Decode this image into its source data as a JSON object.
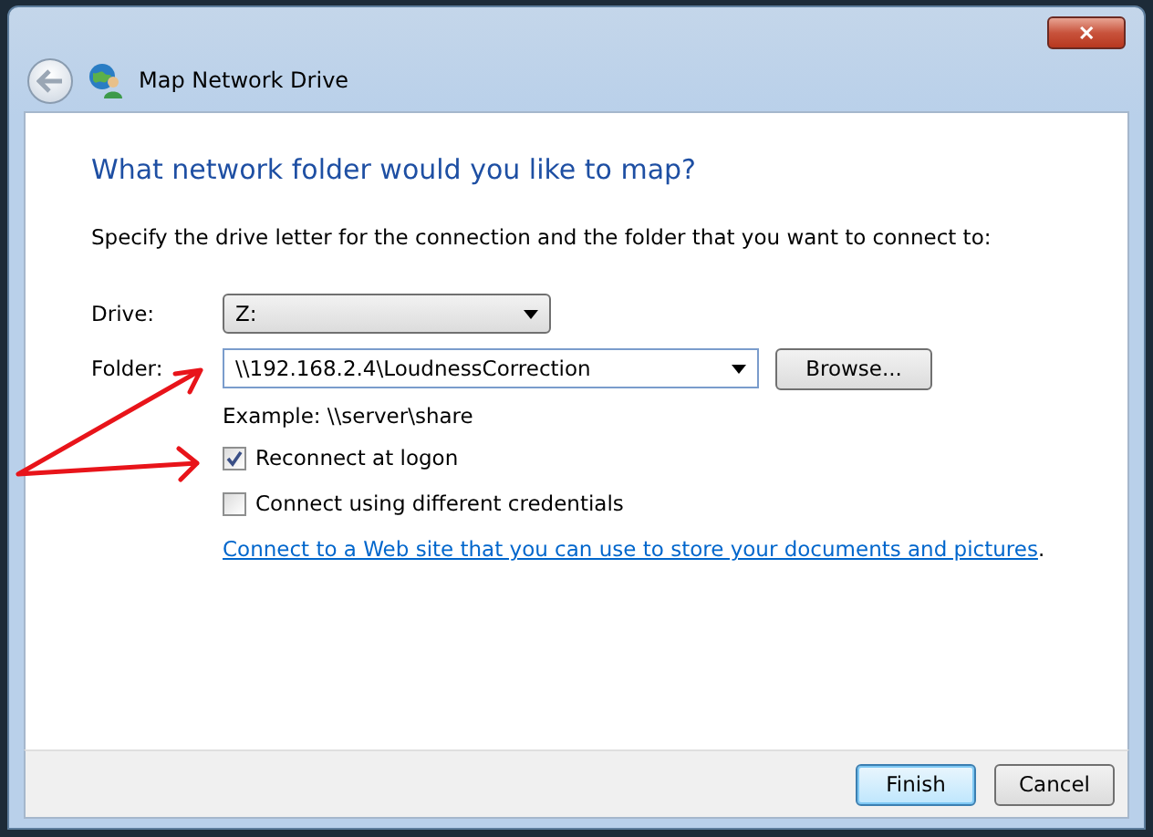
{
  "window": {
    "title": "Map Network Drive",
    "close": "✕"
  },
  "heading": "What network folder would you like to map?",
  "description": "Specify the drive letter for the connection and the folder that you want to connect to:",
  "drive": {
    "label": "Drive:",
    "value": "Z:"
  },
  "folder": {
    "label": "Folder:",
    "value": "\\\\192.168.2.4\\LoudnessCorrection",
    "browse": "Browse..."
  },
  "example": "Example: \\\\server\\share",
  "options": [
    {
      "label": "Reconnect at logon",
      "checked": true
    },
    {
      "label": "Connect using different credentials",
      "checked": false
    }
  ],
  "link": "Connect to a Web site that you can use to store your documents and pictures",
  "link_suffix": ".",
  "annotation_arrows": true,
  "buttons": [
    {
      "label": "Finish",
      "default": true
    },
    {
      "label": "Cancel",
      "default": false
    }
  ]
}
